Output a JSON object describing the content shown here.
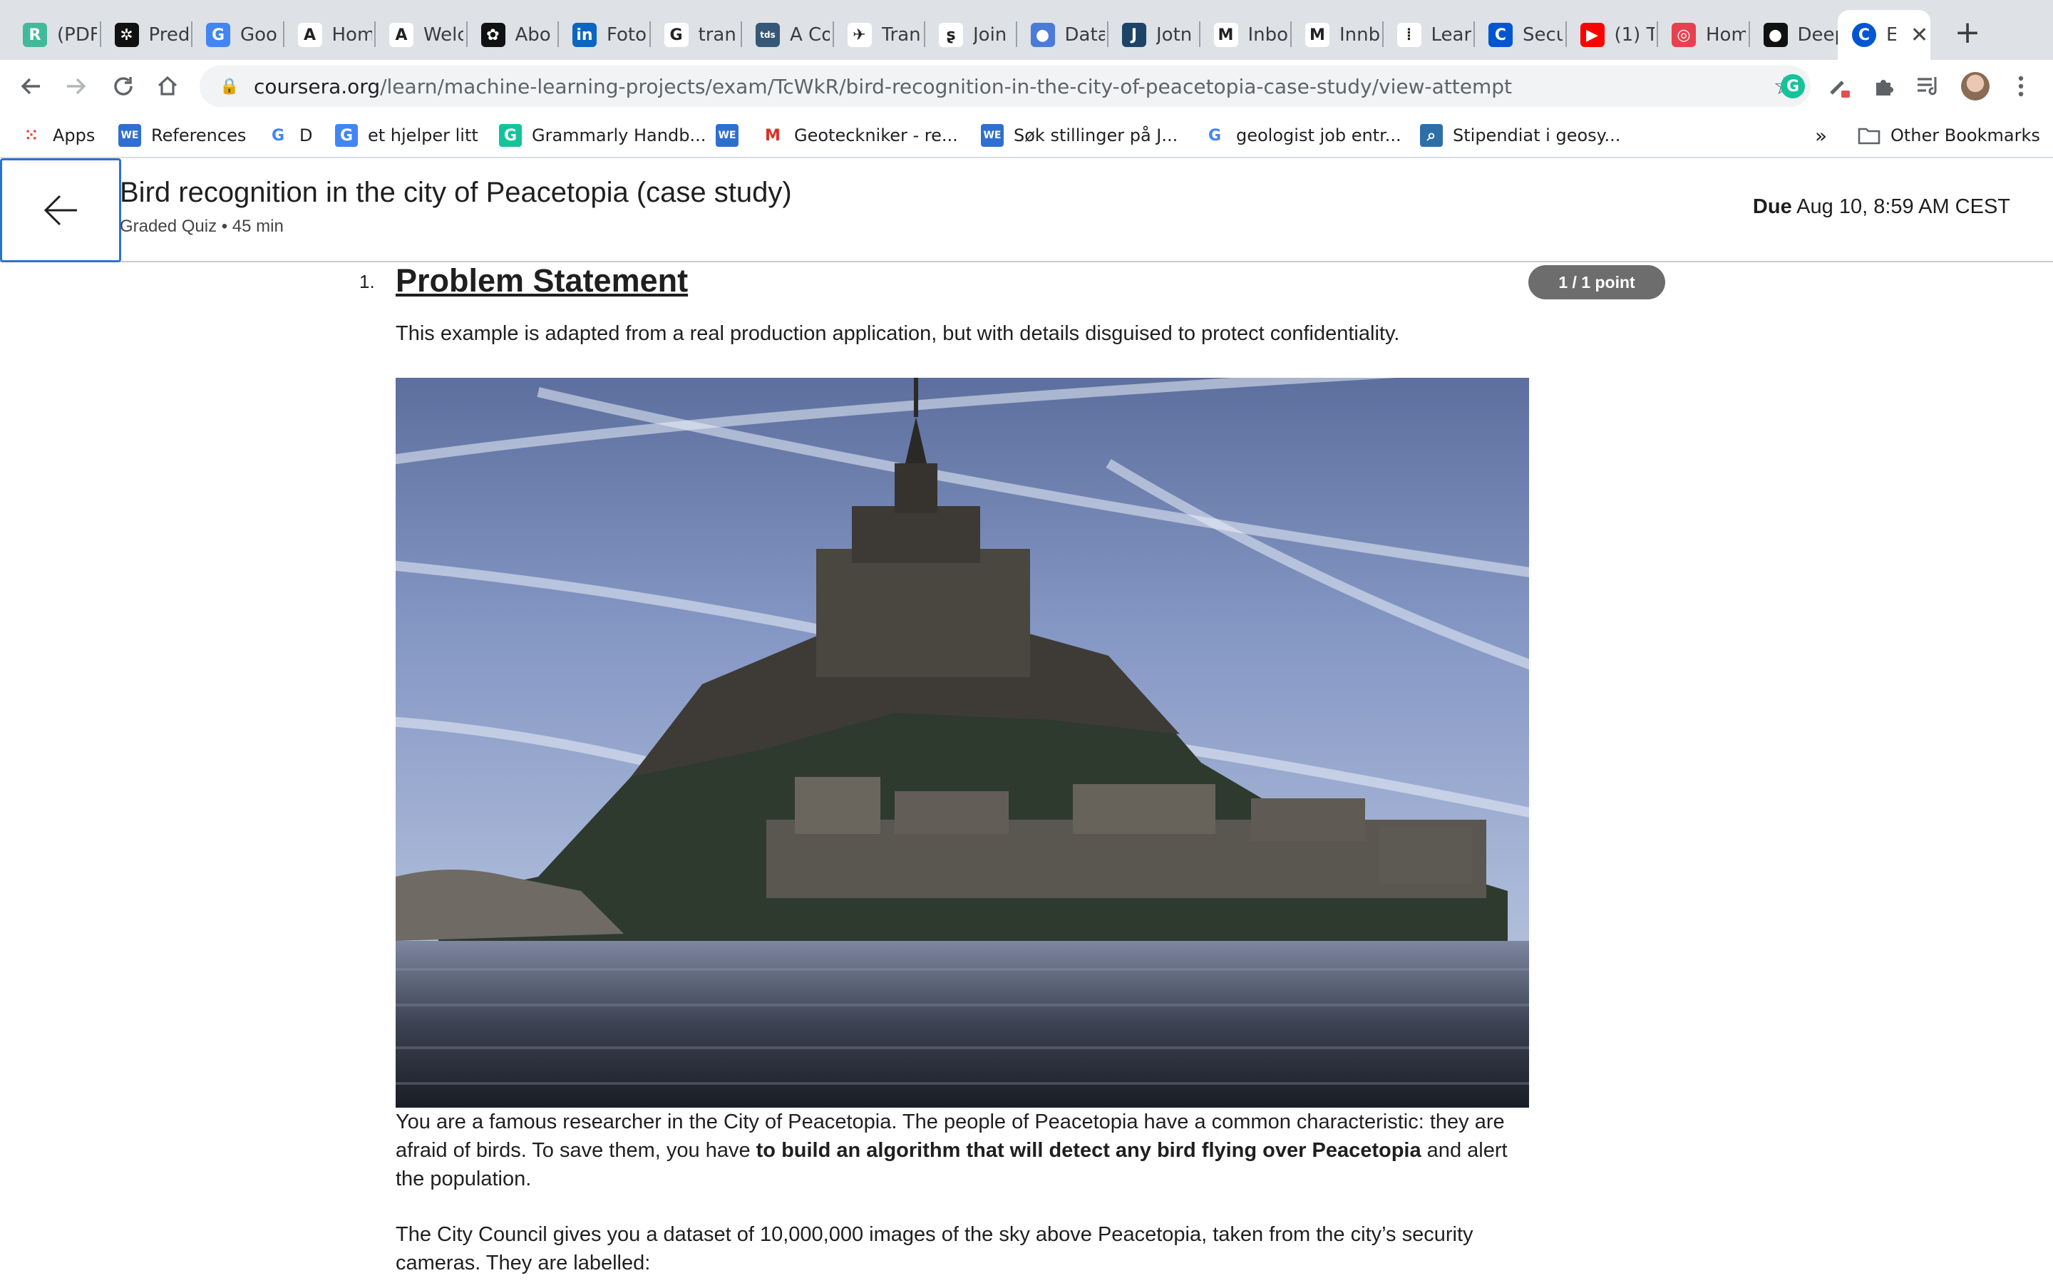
{
  "tabs": [
    {
      "title": "(PDF",
      "icon": "researchgate-icon",
      "color": "#40ba9b",
      "glyph": "R"
    },
    {
      "title": "Pred",
      "icon": "gear-logo-icon",
      "color": "#111111",
      "glyph": "✲"
    },
    {
      "title": "Goo",
      "icon": "google-translate-icon",
      "color": "#4285f4",
      "glyph": "G"
    },
    {
      "title": "Hom",
      "icon": "medium-a-icon",
      "color": "#ffffff",
      "glyph": "A"
    },
    {
      "title": "Welc",
      "icon": "medium-a-icon",
      "color": "#ffffff",
      "glyph": "A"
    },
    {
      "title": "Abo",
      "icon": "openai-icon",
      "color": "#111111",
      "glyph": "✿"
    },
    {
      "title": "Foto",
      "icon": "linkedin-icon",
      "color": "#0a66c2",
      "glyph": "in"
    },
    {
      "title": "tran",
      "icon": "google-icon",
      "color": "#ffffff",
      "glyph": "G"
    },
    {
      "title": "A Co",
      "icon": "tds-icon",
      "color": "#355876",
      "glyph": "tds"
    },
    {
      "title": "Tran",
      "icon": "drone-icon",
      "color": "#ffffff",
      "glyph": "✈"
    },
    {
      "title": "Join",
      "icon": "link-icon",
      "color": "#ffffff",
      "glyph": "ʂ"
    },
    {
      "title": "Data",
      "icon": "drop-icon",
      "color": "#4a7bd8",
      "glyph": "●"
    },
    {
      "title": "Jotn",
      "icon": "j-icon",
      "color": "#1d4466",
      "glyph": "J"
    },
    {
      "title": "Inbo",
      "icon": "gmail-icon",
      "color": "#ffffff",
      "glyph": "M"
    },
    {
      "title": "Innb",
      "icon": "gmail-icon",
      "color": "#ffffff",
      "glyph": "M"
    },
    {
      "title": "Lear",
      "icon": "bars-icon",
      "color": "#ffffff",
      "glyph": "⦙"
    },
    {
      "title": "Secu",
      "icon": "coursera-icon",
      "color": "#0056d2",
      "glyph": "C"
    },
    {
      "title": "(1) T",
      "icon": "youtube-icon",
      "color": "#ff0000",
      "glyph": "▶"
    },
    {
      "title": "Hom",
      "icon": "target-icon",
      "color": "#e8404f",
      "glyph": "◎"
    },
    {
      "title": "Deep",
      "icon": "github-icon",
      "color": "#111111",
      "glyph": "●"
    }
  ],
  "active_tab": {
    "title": "E",
    "icon": "coursera-icon",
    "color": "#0056d2",
    "glyph": "C"
  },
  "url": {
    "host": "coursera.org",
    "path": "/learn/machine-learning-projects/exam/TcWkR/bird-recognition-in-the-city-of-peacetopia-case-study/view-attempt"
  },
  "bookmarks": [
    {
      "label": "Apps",
      "icon": "apps-grid-icon"
    },
    {
      "label": "References",
      "icon": "we-icon"
    },
    {
      "label": "D",
      "icon": "google-icon"
    },
    {
      "label": "et hjelper litt",
      "icon": "google-translate-icon"
    },
    {
      "label": "Grammarly Handb...",
      "icon": "grammarly-icon"
    },
    {
      "label": "",
      "icon": "we-icon"
    },
    {
      "label": "Geoteckniker - re...",
      "icon": "gmail-icon"
    },
    {
      "label": "Søk stillinger på J...",
      "icon": "we-icon"
    },
    {
      "label": "geologist job entr...",
      "icon": "google-icon"
    },
    {
      "label": "Stipendiat i geosy...",
      "icon": "search-doc-icon"
    }
  ],
  "bookmarks_overflow": "»",
  "other_bookmarks": "Other Bookmarks",
  "quiz": {
    "title": "Bird recognition in the city of Peacetopia (case study)",
    "subtitle": "Graded Quiz • 45 min",
    "due_label": "Due",
    "due_value": "Aug 10, 8:59 AM CEST"
  },
  "question": {
    "number": "1.",
    "title": "Problem Statement",
    "points": "1 / 1 point",
    "intro": "This example is adapted from a real production application, but with details disguised to protect confidentiality.",
    "p1_a": "You are a famous researcher in the City of Peacetopia. The people of Peacetopia have a common characteristic: they are afraid of birds. To save them, you have ",
    "p1_bold": "to build an algorithm that will detect any bird flying over Peacetopia",
    "p1_c": " and alert the population.",
    "p2": "The City Council gives you a dataset of 10,000,000 images of the sky above Peacetopia, taken from the city’s security cameras. They are labelled:"
  }
}
